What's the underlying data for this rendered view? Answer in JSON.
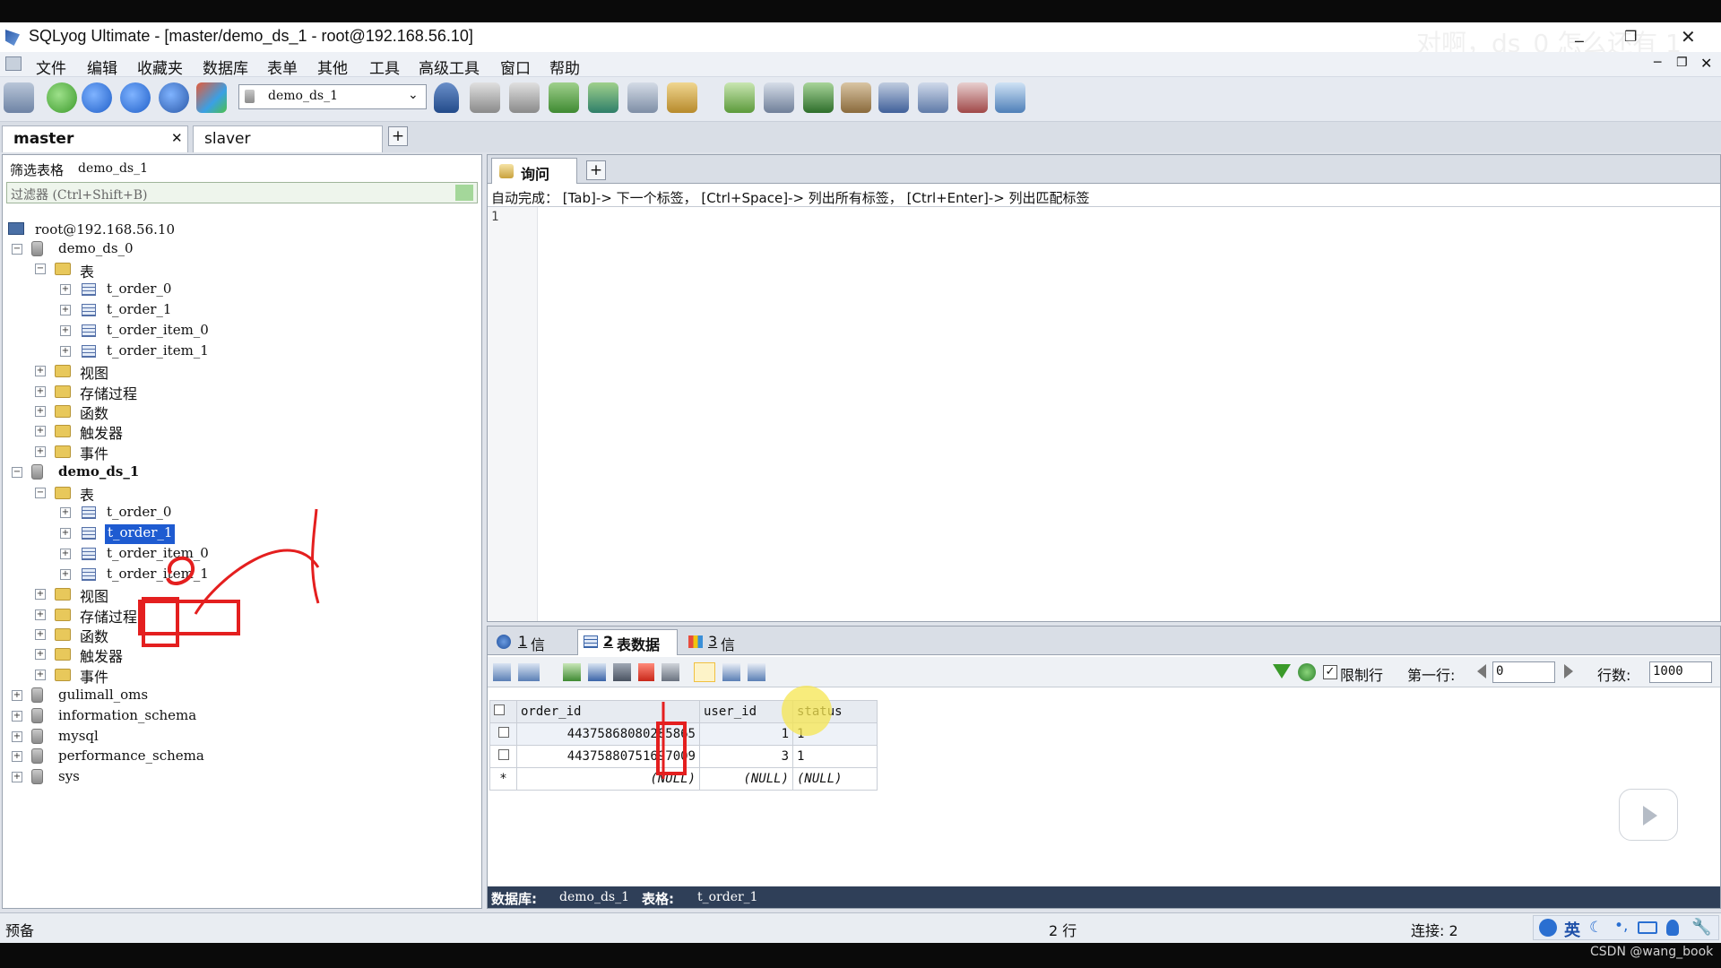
{
  "window": {
    "title": "SQLyog Ultimate - [master/demo_ds_1 - root@192.168.56.10]"
  },
  "danmaku": "对啊，ds_0 怎么还有 1",
  "menu": [
    "文件",
    "编辑",
    "收藏夹",
    "数据库",
    "表单",
    "其他",
    "工具",
    "高级工具",
    "窗口",
    "帮助"
  ],
  "toolbar": {
    "db_select": "demo_ds_1"
  },
  "connection_tabs": [
    "master",
    "slaver"
  ],
  "left": {
    "filter_label": "筛选表格",
    "filter_db": "demo_ds_1",
    "filter_placeholder": "过滤器 (Ctrl+Shift+B)",
    "root": "root@192.168.56.10",
    "db0": "demo_ds_0",
    "db0_children": {
      "tables": "表",
      "views": "视图",
      "procs": "存储过程",
      "funcs": "函数",
      "triggers": "触发器",
      "events": "事件"
    },
    "db0_tables": [
      "t_order_0",
      "t_order_1",
      "t_order_item_0",
      "t_order_item_1"
    ],
    "db1": "demo_ds_1",
    "db1_children": {
      "tables": "表",
      "views": "视图",
      "procs": "存储过程",
      "funcs": "函数",
      "triggers": "触发器",
      "events": "事件"
    },
    "db1_tables": [
      "t_order_0",
      "t_order_1",
      "t_order_item_0",
      "t_order_item_1"
    ],
    "other_dbs": [
      "gulimall_oms",
      "information_schema",
      "mysql",
      "performance_schema",
      "sys"
    ]
  },
  "query": {
    "tab_label": "询问",
    "autocomplete_hint": "自动完成：  [Tab]-> 下一个标签，  [Ctrl+Space]-> 列出所有标签，  [Ctrl+Enter]-> 列出匹配标签",
    "line_number": "1"
  },
  "results": {
    "tabs": [
      {
        "num": "1",
        "label": "信息"
      },
      {
        "num": "2",
        "label": "表数据"
      },
      {
        "num": "3",
        "label": "信息"
      }
    ],
    "limit_rows_label": "限制行",
    "first_row_label": "第一行:",
    "first_row_value": "0",
    "rows_label": "行数:",
    "rows_value": "1000",
    "columns": [
      "order_id",
      "user_id",
      "status"
    ],
    "rows": [
      {
        "order_id": "443758680802858",
        "order_id_main": "44375868080285",
        "order_id_tail": "865",
        "user_id": "1",
        "status": "1"
      },
      {
        "order_id": "443758807516970",
        "order_id_main": "44375880751697",
        "order_id_tail": "009",
        "user_id": "3",
        "status": "1"
      }
    ],
    "null_text": "(NULL)",
    "footer_db_label": "数据库:",
    "footer_db": "demo_ds_1",
    "footer_table_label": "表格:",
    "footer_table": "t_order_1"
  },
  "status": {
    "left": "预备",
    "rows": "2 行",
    "connections": "连接: 2",
    "ime": "英"
  },
  "watermark": "CSDN @wang_book",
  "colors": {
    "accent_blue": "#2a5fae",
    "annotation_red": "#e41f1f",
    "selection": "#1e5bd1"
  }
}
